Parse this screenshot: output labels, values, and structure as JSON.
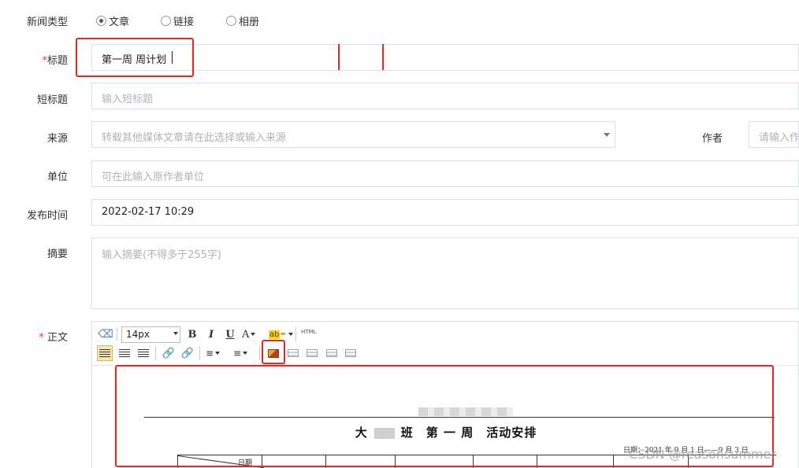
{
  "form": {
    "news_type": {
      "label": "新闻类型",
      "options": [
        {
          "label": "文章",
          "selected": true
        },
        {
          "label": "链接",
          "selected": false
        },
        {
          "label": "相册",
          "selected": false
        }
      ]
    },
    "title": {
      "label": "标题",
      "required_mark": "*",
      "value": "第一周 周计划"
    },
    "short_title": {
      "label": "短标题",
      "placeholder": "输入短标题"
    },
    "source": {
      "label": "来源",
      "placeholder": "转载其他媒体文章请在此选择或输入来源"
    },
    "author": {
      "label": "作者",
      "placeholder": "请输入作"
    },
    "unit": {
      "label": "单位",
      "placeholder": "可在此输入原作者单位"
    },
    "publish_time": {
      "label": "发布时间",
      "value": "2022-02-17 10:29"
    },
    "summary": {
      "label": "摘要",
      "placeholder": "输入摘要(不得多于255字)"
    },
    "body": {
      "label": "正文",
      "required_mark": "*"
    }
  },
  "editor": {
    "font_size": "14px",
    "bold": "B",
    "italic": "I",
    "underline": "U",
    "font_color": "A",
    "highlight": "ab",
    "html": "HTML",
    "doc": {
      "title_left": "大",
      "title_right": "班　第 一 周　活动安排",
      "date_line": "日期：2021 年 9 月 1 日——9 月 3 日",
      "table_header": "日期"
    }
  },
  "watermark": "CSDN @reasonsummer",
  "colors": {
    "annotation": "#e8251f",
    "border": "#dcdfe6",
    "placeholder": "#b0b3b8"
  }
}
